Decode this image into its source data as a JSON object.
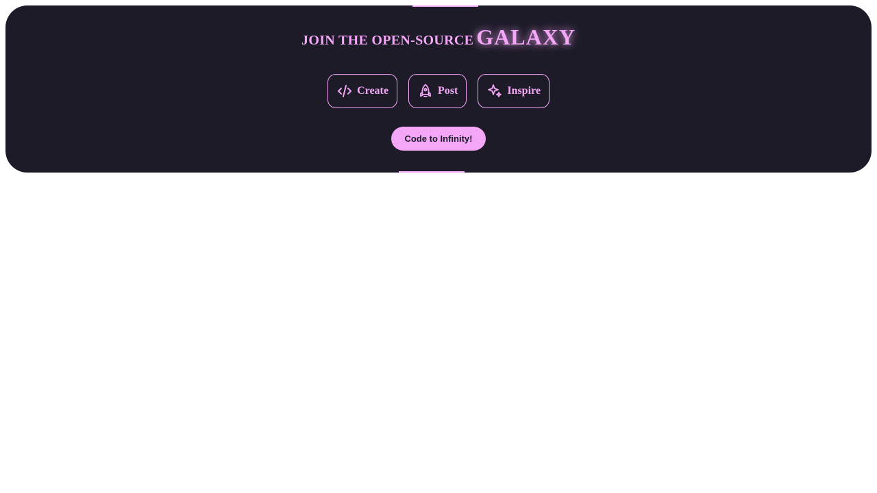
{
  "banner": {
    "headline_lead": "JOIN THE OPEN-SOURCE",
    "headline_highlight": "GALAXY",
    "accent_color": "#f4a6f7",
    "background_color": "#1c1b27"
  },
  "actions": [
    {
      "label": "Create",
      "icon": "code-icon"
    },
    {
      "label": "Post",
      "icon": "rocket-icon"
    },
    {
      "label": "Inspire",
      "icon": "sparkles-icon"
    }
  ],
  "cta": {
    "label": "Code to Infinity!"
  }
}
